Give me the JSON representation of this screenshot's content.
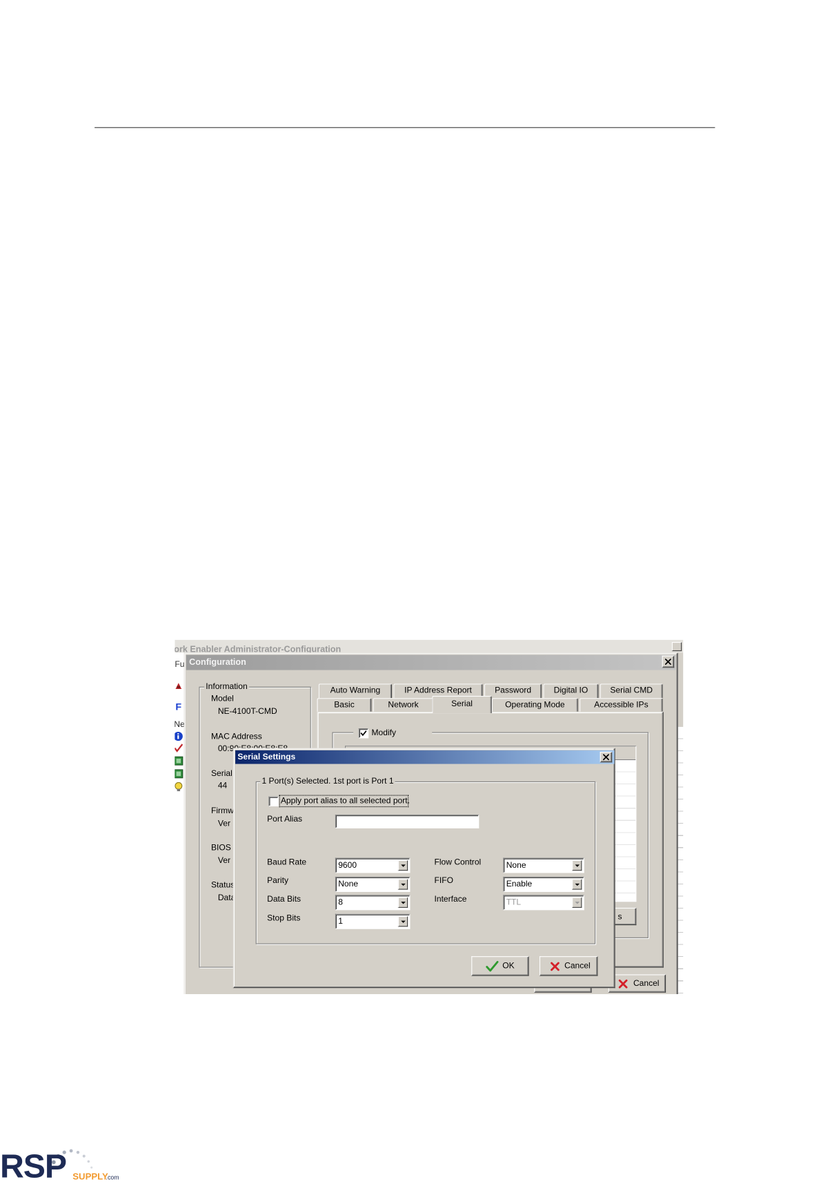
{
  "background_window": {
    "title": "ork Enabler Administrator-Configuration",
    "menu_fragment": "Fu",
    "sidebar_fragments": {
      "f": "F",
      "ne": "Ne"
    }
  },
  "config_dialog": {
    "title": "Configuration",
    "information": {
      "caption": "Information",
      "model_label": "Model",
      "model_value": "NE-4100T-CMD",
      "mac_label": "MAC Address",
      "mac_value": "00:90:E8:00:E8:E8",
      "serial_label": "Serial",
      "serial_value": "44",
      "firmware_label": "Firmw",
      "firmware_ver": "Ver",
      "bios_label": "BIOS",
      "bios_ver": "Ver",
      "status_label": "Status",
      "status_data": "Data"
    },
    "tabs_row1": [
      {
        "label": "Auto Warning"
      },
      {
        "label": "IP Address Report"
      },
      {
        "label": "Password"
      },
      {
        "label": "Digital IO"
      },
      {
        "label": "Serial CMD"
      }
    ],
    "tabs_row2": [
      {
        "label": "Basic",
        "selected": false
      },
      {
        "label": "Network",
        "selected": false
      },
      {
        "label": "Serial",
        "selected": true
      },
      {
        "label": "Operating Mode",
        "selected": false
      },
      {
        "label": "Accessible IPs",
        "selected": false
      }
    ],
    "modify_label": "Modify",
    "modify_checked": true,
    "settings_button_fragment": "s",
    "cancel_label": "Cancel"
  },
  "serial_settings_dialog": {
    "title": "Serial Settings",
    "group_caption": "1 Port(s) Selected. 1st port is Port 1",
    "apply_alias_label": "Apply port alias to all selected port.",
    "apply_alias_checked": false,
    "port_alias_label": "Port Alias",
    "port_alias_value": "",
    "baud_rate": {
      "label": "Baud Rate",
      "value": "9600"
    },
    "parity": {
      "label": "Parity",
      "value": "None"
    },
    "data_bits": {
      "label": "Data Bits",
      "value": "8"
    },
    "stop_bits": {
      "label": "Stop Bits",
      "value": "1"
    },
    "flow_control": {
      "label": "Flow Control",
      "value": "None"
    },
    "fifo": {
      "label": "FIFO",
      "value": "Enable"
    },
    "interface": {
      "label": "Interface",
      "value": "TTL",
      "disabled": true
    },
    "ok_label": "OK",
    "cancel_label": "Cancel"
  },
  "footer_logo": {
    "rsp": "RSP",
    "supply": "SUPPLY",
    "com": ".com"
  },
  "icons": {
    "close": "close-icon",
    "ok": "check-icon",
    "cancel": "x-icon",
    "dropdown": "dropdown-arrow-icon"
  },
  "colors": {
    "window_face": "#d4d0c8",
    "active_title_start": "#0a246a",
    "active_title_end": "#a6caf0",
    "inactive_title": "#9c9c9c",
    "logo_navy": "#1e2b55",
    "logo_orange": "#f29b31"
  }
}
